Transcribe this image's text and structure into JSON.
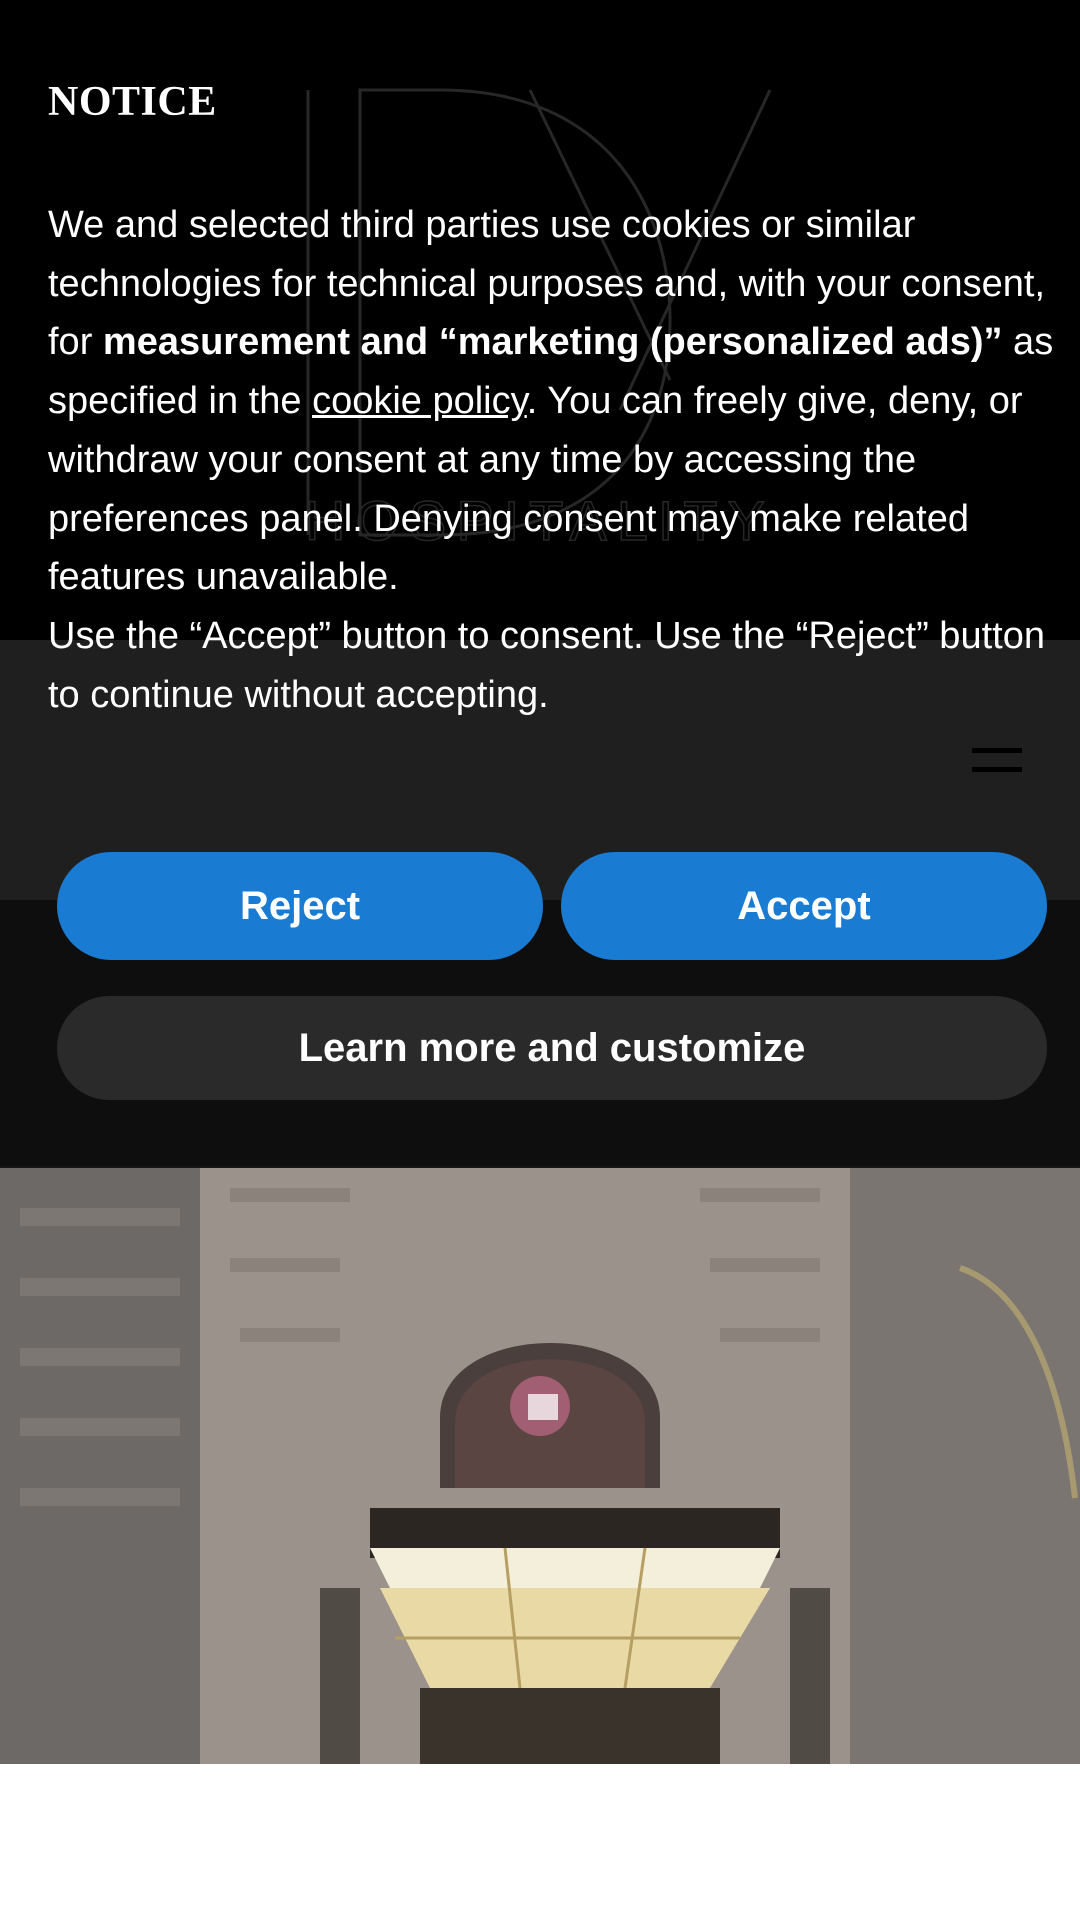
{
  "site": {
    "brand_wordmark": "HOSPITALITY",
    "menu_icon": "hamburger-menu-icon",
    "hero_image_alt": "hotel entrance at night"
  },
  "consent": {
    "title": "NOTICE",
    "body": {
      "p1_start": "We and selected third parties use cookies or similar technologies for technical purposes and, with your consent, for ",
      "p1_bold": "measurement and “marketing (personalized ads)”",
      "p1_mid": " as specified in the ",
      "p1_link": "cookie policy",
      "p1_end": ". You can freely give, deny, or withdraw your consent at any time by accessing the preferences panel. Denying consent may make related features unavailable.",
      "p2": "Use the “Accept” button to consent. Use the “Reject” button to continue without accepting."
    },
    "buttons": {
      "reject": "Reject",
      "accept": "Accept",
      "customize": "Learn more and customize"
    }
  },
  "colors": {
    "primary_button": "#1a7bd2",
    "secondary_button": "#2a2a2a",
    "header_bg": "#000000"
  }
}
